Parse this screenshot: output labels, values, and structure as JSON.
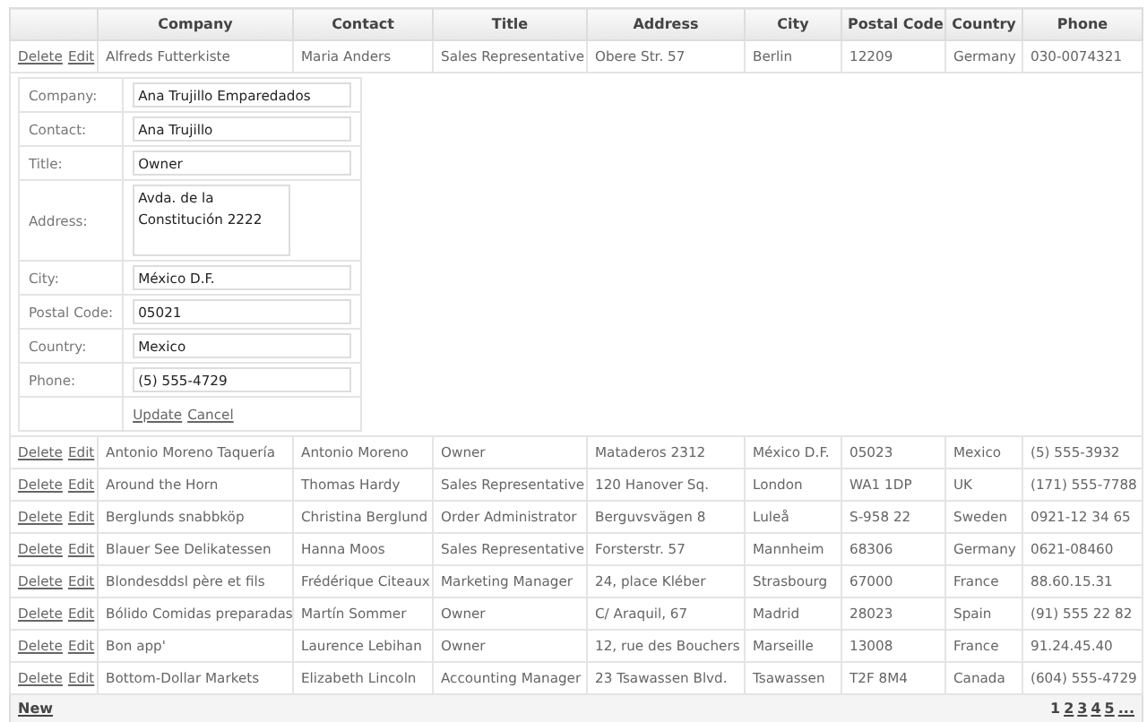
{
  "table": {
    "columns": [
      "Company",
      "Contact",
      "Title",
      "Address",
      "City",
      "Postal Code",
      "Country",
      "Phone"
    ],
    "rows": [
      {
        "kind": "data",
        "actions": [
          "Delete",
          "Edit"
        ],
        "cells": [
          "Alfreds Futterkiste",
          "Maria Anders",
          "Sales Representative",
          "Obere Str. 57",
          "Berlin",
          "12209",
          "Germany",
          "030-0074321"
        ]
      },
      {
        "kind": "edit",
        "fields": [
          {
            "label": "Company:",
            "kind": "text",
            "value": "Ana Trujillo Emparedados"
          },
          {
            "label": "Contact:",
            "kind": "text",
            "value": "Ana Trujillo"
          },
          {
            "label": "Title:",
            "kind": "text",
            "value": "Owner"
          },
          {
            "label": "Address:",
            "kind": "multiline",
            "value": "Avda. de la Constitución 2222"
          },
          {
            "label": "City:",
            "kind": "text",
            "value": "México D.F."
          },
          {
            "label": "Postal Code:",
            "kind": "text",
            "value": "05021"
          },
          {
            "label": "Country:",
            "kind": "text",
            "value": "Mexico"
          },
          {
            "label": "Phone:",
            "kind": "text",
            "value": "(5) 555-4729"
          }
        ],
        "actions": [
          "Update",
          "Cancel"
        ]
      },
      {
        "kind": "data",
        "actions": [
          "Delete",
          "Edit"
        ],
        "cells": [
          "Antonio Moreno Taquería",
          "Antonio Moreno",
          "Owner",
          "Mataderos 2312",
          "México D.F.",
          "05023",
          "Mexico",
          "(5) 555-3932"
        ]
      },
      {
        "kind": "data",
        "actions": [
          "Delete",
          "Edit"
        ],
        "cells": [
          "Around the Horn",
          "Thomas Hardy",
          "Sales Representative",
          "120 Hanover Sq.",
          "London",
          "WA1 1DP",
          "UK",
          "(171) 555-7788"
        ]
      },
      {
        "kind": "data",
        "actions": [
          "Delete",
          "Edit"
        ],
        "cells": [
          "Berglunds snabbköp",
          "Christina Berglund",
          "Order Administrator",
          "Berguvsvägen 8",
          "Luleå",
          "S-958 22",
          "Sweden",
          "0921-12 34 65"
        ]
      },
      {
        "kind": "data",
        "actions": [
          "Delete",
          "Edit"
        ],
        "cells": [
          "Blauer See Delikatessen",
          "Hanna Moos",
          "Sales Representative",
          "Forsterstr. 57",
          "Mannheim",
          "68306",
          "Germany",
          "0621-08460"
        ]
      },
      {
        "kind": "data",
        "actions": [
          "Delete",
          "Edit"
        ],
        "cells": [
          "Blondesddsl père et fils",
          "Frédérique Citeaux",
          "Marketing Manager",
          "24, place Kléber",
          "Strasbourg",
          "67000",
          "France",
          "88.60.15.31"
        ]
      },
      {
        "kind": "data",
        "actions": [
          "Delete",
          "Edit"
        ],
        "cells": [
          "Bólido Comidas preparadas",
          "Martín Sommer",
          "Owner",
          "C/ Araquil, 67",
          "Madrid",
          "28023",
          "Spain",
          "(91) 555 22 82"
        ]
      },
      {
        "kind": "data",
        "actions": [
          "Delete",
          "Edit"
        ],
        "cells": [
          "Bon app'",
          "Laurence Lebihan",
          "Owner",
          "12, rue des Bouchers",
          "Marseille",
          "13008",
          "France",
          "91.24.45.40"
        ]
      },
      {
        "kind": "data",
        "actions": [
          "Delete",
          "Edit"
        ],
        "cells": [
          "Bottom-Dollar Markets",
          "Elizabeth Lincoln",
          "Accounting Manager",
          "23 Tsawassen Blvd.",
          "Tsawassen",
          "T2F 8M4",
          "Canada",
          "(604) 555-4729"
        ]
      }
    ]
  },
  "footer": {
    "new_link": "New",
    "pages": [
      {
        "label": "1",
        "selected": true
      },
      {
        "label": "2",
        "selected": false
      },
      {
        "label": "3",
        "selected": false
      },
      {
        "label": "4",
        "selected": false
      },
      {
        "label": "5",
        "selected": false
      },
      {
        "label": "...",
        "selected": false
      }
    ]
  }
}
